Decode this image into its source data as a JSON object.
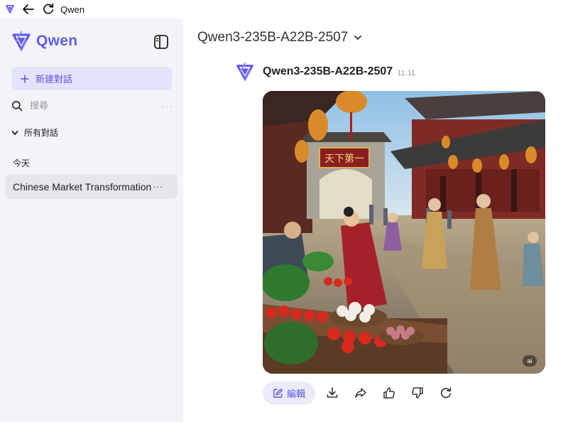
{
  "window": {
    "title": "Qwen",
    "back_icon": "arrow-left-icon",
    "reload_icon": "reload-icon"
  },
  "sidebar": {
    "brand_name": "Qwen",
    "brand_color": "#615ced",
    "new_chat_label": "新建對話",
    "search_placeholder": "搜尋",
    "search_more": "···",
    "all_chats_label": "所有對話",
    "section_today": "今天",
    "chats": [
      {
        "title": "Chinese Market Transformation",
        "more": "···"
      }
    ]
  },
  "main": {
    "model_name": "Qwen3-235B-A22B-2507",
    "message": {
      "sender": "Qwen3-235B-A22B-2507",
      "time": "11:11",
      "image": {
        "sign_text": "天下第一",
        "ai_badge": "ai"
      },
      "actions": {
        "edit_label": "編輯",
        "icons": [
          "download-icon",
          "share-icon",
          "thumbs-up-icon",
          "thumbs-down-icon",
          "regenerate-icon"
        ]
      }
    }
  },
  "colors": {
    "sidebar_bg": "#f3f4f8",
    "accent": "#615ced",
    "accent_soft": "#e3e3fb"
  }
}
